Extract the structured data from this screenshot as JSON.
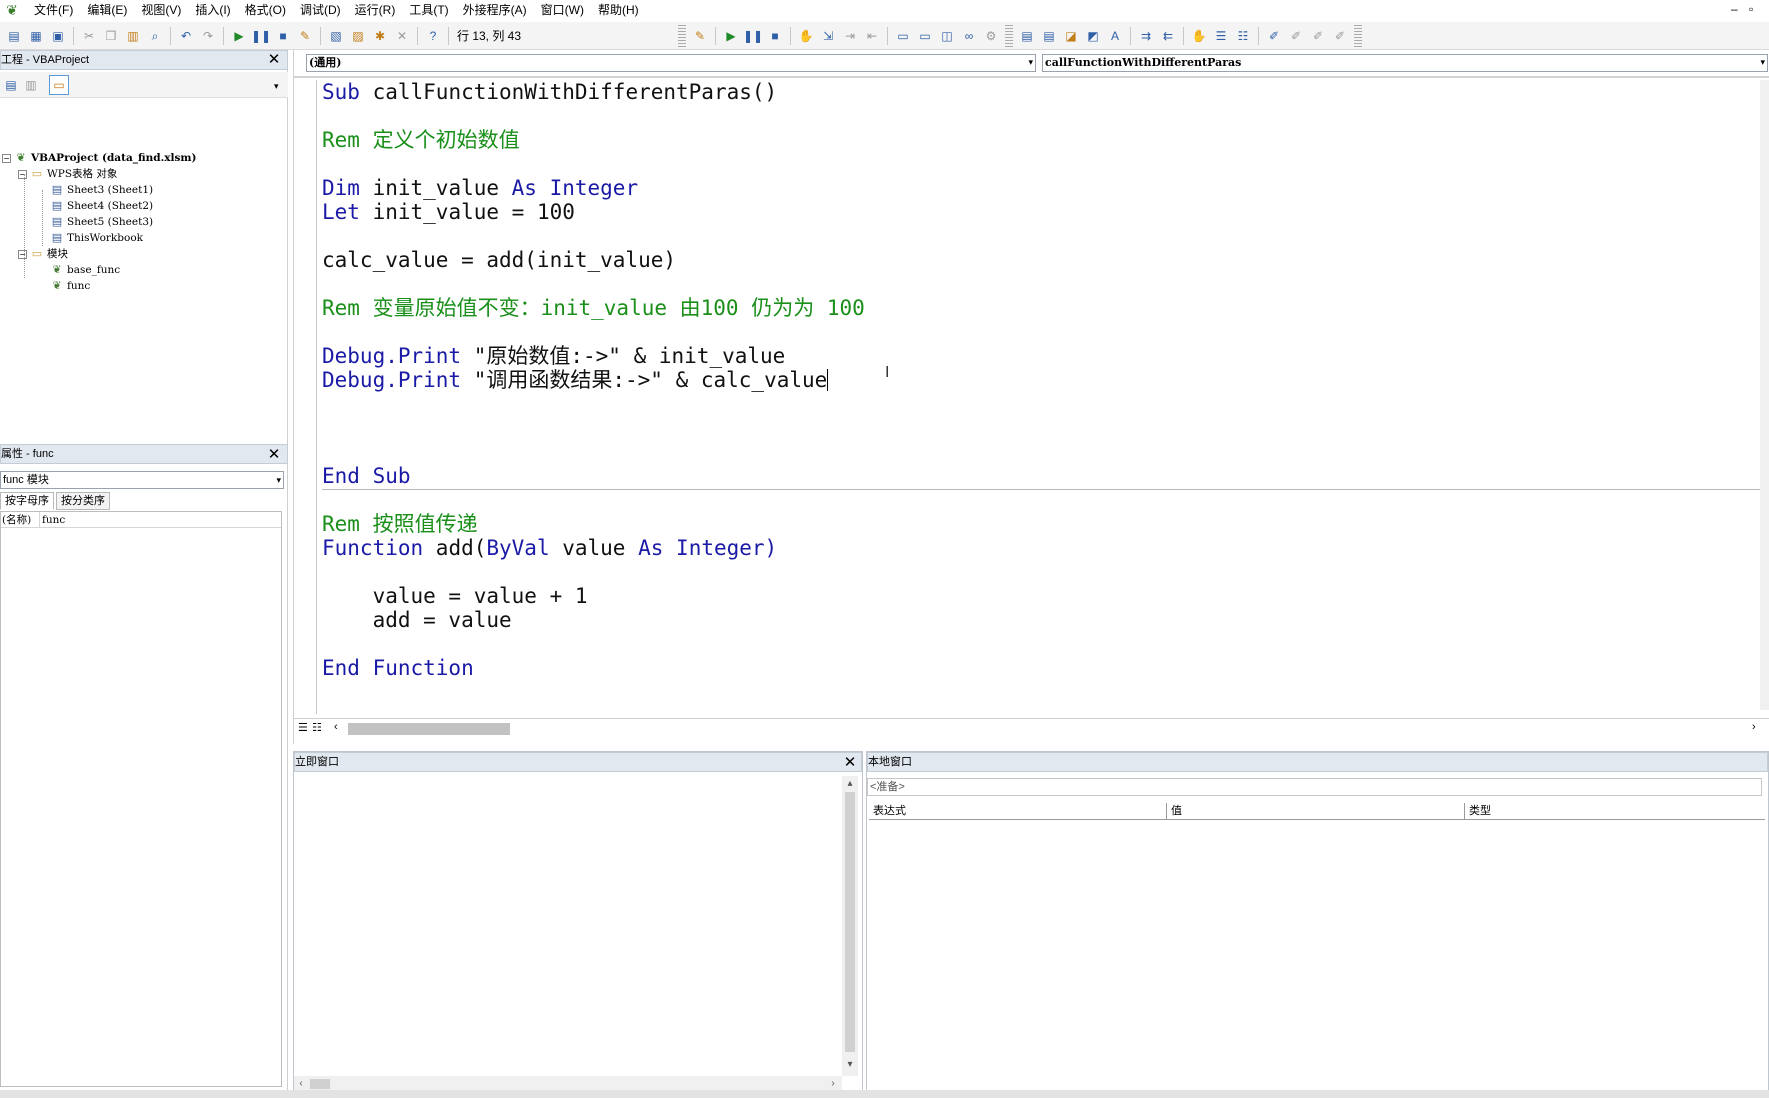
{
  "menu": {
    "items": [
      "文件(F)",
      "编辑(E)",
      "视图(V)",
      "插入(I)",
      "格式(O)",
      "调试(D)",
      "运行(R)",
      "工具(T)",
      "外接程序(A)",
      "窗口(W)",
      "帮助(H)"
    ],
    "min": "–",
    "restore": "▫"
  },
  "toolbar": {
    "position_text": "行 13, 列 43"
  },
  "project_panel": {
    "title": "工程 - VBAProject",
    "tree": {
      "root": "VBAProject (data_find.xlsm)",
      "objects_folder": "WPS表格 对象",
      "sheets": [
        "Sheet3 (Sheet1)",
        "Sheet4 (Sheet2)",
        "Sheet5 (Sheet3)",
        "ThisWorkbook"
      ],
      "modules_folder": "模块",
      "modules": [
        "base_func",
        "func"
      ]
    }
  },
  "props_panel": {
    "title": "属性 - func",
    "object_select": "func 模块",
    "tabs": [
      "按字母序",
      "按分类序"
    ],
    "row_name": "(名称)",
    "row_value": "func"
  },
  "code_window": {
    "object_dropdown": "(通用)",
    "proc_dropdown": "callFunctionWithDifferentParas",
    "lines": [
      {
        "kw": "Sub",
        "rest": " callFunctionWithDifferentParas()"
      },
      {
        "comment": "Rem 定义个初始数值"
      },
      {
        "kw": "Dim",
        "rest": " init_value ",
        "kw2": "As",
        "rest2": " Integer"
      },
      {
        "kw": "Let",
        "rest": " init_value = 100"
      },
      {
        "plain": "calc_value = add(init_value)"
      },
      {
        "comment": "Rem 变量原始值不变：init_value 由100 仍为为 100"
      },
      {
        "kw": "Debug.Print",
        "rest": " \"原始数值:->\" & init_value"
      },
      {
        "kw": "Debug.Print",
        "rest": " \"调用函数结果:->\" & calc_value"
      },
      {
        "kw": "End Sub"
      },
      {
        "comment": "Rem 按照值传递"
      },
      {
        "kw": "Function",
        "rest": " add(",
        "kw2": "ByVal",
        "rest2": " value ",
        "kw3": "As",
        "rest3": " Integer)"
      },
      {
        "plain": "    value = value + 1"
      },
      {
        "plain": "    add = value"
      },
      {
        "kw": "End Function"
      }
    ]
  },
  "immediate_window": {
    "title": "立即窗口"
  },
  "locals_window": {
    "title": "本地窗口",
    "status": "<准备>",
    "columns": [
      "表达式",
      "值",
      "类型"
    ]
  },
  "colors": {
    "keyword": "#1a1aa6",
    "comment": "#1a8f1a",
    "panel_title_bg": "#e1e8ef"
  }
}
